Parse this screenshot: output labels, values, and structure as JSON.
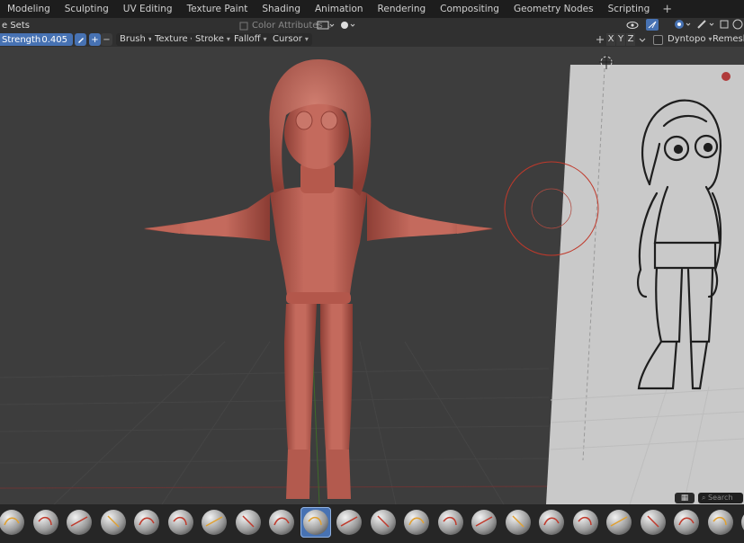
{
  "workspace_tabs": [
    "Modeling",
    "Sculpting",
    "UV Editing",
    "Texture Paint",
    "Shading",
    "Animation",
    "Rendering",
    "Compositing",
    "Geometry Nodes",
    "Scripting"
  ],
  "add_tab_label": "+",
  "header1": {
    "face_sets_label": "e Sets",
    "color_attributes_label": "Color Attributes"
  },
  "header2": {
    "strength_label": "Strength",
    "strength_value": "0.405",
    "add_label": "+",
    "subtract_label": "−",
    "brush_menu": "Brush",
    "texture_menu": "Texture",
    "stroke_menu": "Stroke",
    "falloff_menu": "Falloff",
    "cursor_menu": "Cursor",
    "axis_x": "X",
    "axis_y": "Y",
    "axis_z": "Z",
    "dyntopo_label": "Dyntopo",
    "remesh_label": "Remesh"
  },
  "asset_shelf": {
    "search_placeholder": "Search"
  },
  "colors": {
    "accent": "#4772b3",
    "clay": "#b85a4e",
    "cursor_ring": "#c0392b"
  },
  "brush_icons": [
    "draw",
    "draw-sharp",
    "clay",
    "clay-strips",
    "clay-thumb",
    "layer",
    "inflate",
    "blob",
    "crease",
    "smooth",
    "flatten",
    "fill",
    "scrape",
    "multiplane-scrape",
    "pinch",
    "grab",
    "elastic-deform",
    "snake-hook",
    "thumb",
    "pose",
    "nudge",
    "rotate",
    "slide-relax",
    "boundary",
    "cloth",
    "simplify",
    "mask"
  ],
  "active_brush_index": 9
}
